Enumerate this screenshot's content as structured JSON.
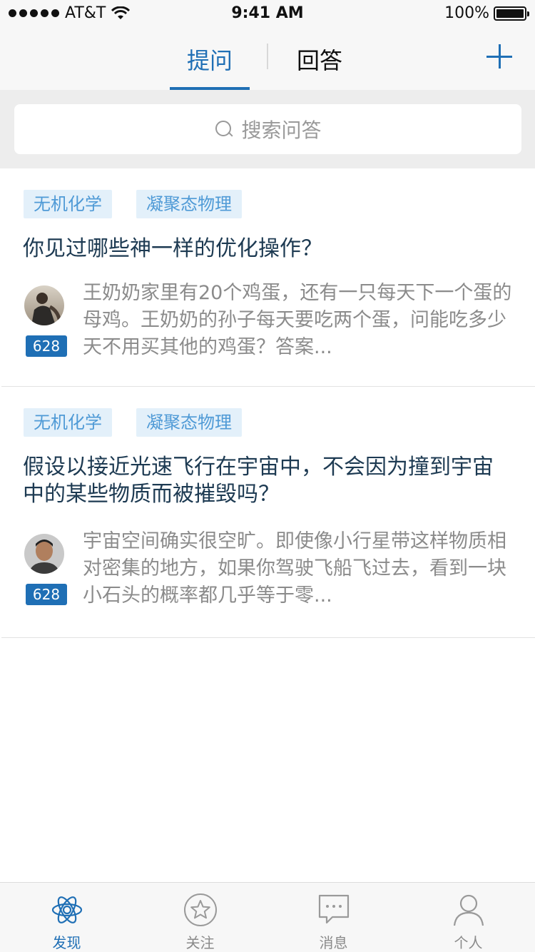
{
  "status_bar": {
    "carrier": "AT&T",
    "time": "9:41 AM",
    "battery": "100%"
  },
  "nav": {
    "tabs": [
      {
        "label": "提问",
        "active": true
      },
      {
        "label": "回答",
        "active": false
      }
    ],
    "add_icon": "plus-icon",
    "accent_color": "#1f6fb5"
  },
  "search": {
    "placeholder": "搜索问答",
    "icon": "search-icon"
  },
  "questions": [
    {
      "tags": [
        "无机化学",
        "凝聚态物理"
      ],
      "title": "你见过哪些神一样的优化操作？",
      "votes": "628",
      "excerpt": "王奶奶家里有20个鸡蛋，还有一只每天下一个蛋的母鸡。王奶奶的孙子每天要吃两个蛋，问能吃多少天不用买其他的鸡蛋？答案..."
    },
    {
      "tags": [
        "无机化学",
        "凝聚态物理"
      ],
      "title": "假设以接近光速飞行在宇宙中，不会因为撞到宇宙中的某些物质而被摧毁吗？",
      "votes": "628",
      "excerpt": "宇宙空间确实很空旷。即使像小行星带这样物质相对密集的地方，如果你驾驶飞船飞过去，看到一块小石头的概率都几乎等于零..."
    }
  ],
  "tab_bar": {
    "items": [
      {
        "label": "发现",
        "icon": "atom-icon",
        "active": true
      },
      {
        "label": "关注",
        "icon": "star-icon",
        "active": false
      },
      {
        "label": "消息",
        "icon": "message-icon",
        "active": false
      },
      {
        "label": "个人",
        "icon": "person-icon",
        "active": false
      }
    ]
  }
}
